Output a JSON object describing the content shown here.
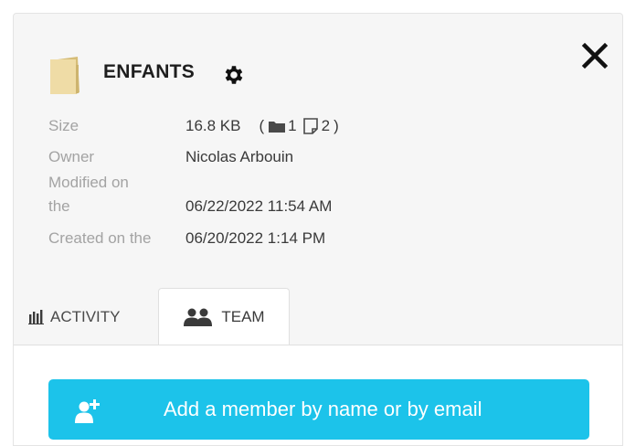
{
  "folder": {
    "name": "ENFANTS",
    "icon": "folder-icon",
    "accent": "#efdca6"
  },
  "details": {
    "size_label": "Size",
    "size_value": "16.8 KB",
    "counts_open": "(",
    "folders_count": "1",
    "files_count": "2",
    "counts_close": ")",
    "owner_label": "Owner",
    "owner_value": "Nicolas Arbouin",
    "modified_label_line1": "Modified on",
    "modified_label_line2": "the",
    "modified_value": "06/22/2022 11:54 AM",
    "created_label": "Created on the",
    "created_value": "06/20/2022 1:14 PM"
  },
  "tabs": {
    "activity_label": "ACTIVITY",
    "team_label": "TEAM",
    "active": "TEAM"
  },
  "team": {
    "add_member_label": "Add a member by name or by email",
    "button_color": "#1cc3ea"
  }
}
